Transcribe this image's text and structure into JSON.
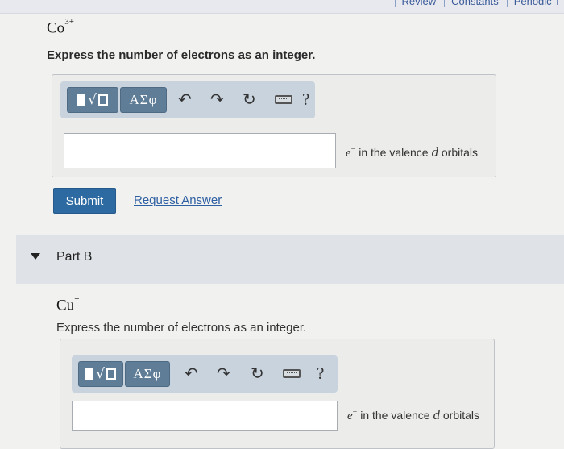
{
  "header": {
    "links": [
      "Review",
      "Constants",
      "Periodic T"
    ]
  },
  "part_a": {
    "species_base": "Co",
    "species_charge": "3+",
    "prompt": "Express the number of electrons as an integer.",
    "toolbar": {
      "template_label": "√",
      "greek_label": "ΑΣφ",
      "help_label": "?"
    },
    "input_value": "",
    "unit_e": "e",
    "unit_e_sup": "−",
    "unit_mid": " in the valence ",
    "unit_d": "d",
    "unit_end": " orbitals",
    "submit_label": "Submit",
    "request_label": "Request Answer"
  },
  "part_b": {
    "title": "Part B",
    "species_base": "Cu",
    "species_charge": "+",
    "prompt": "Express the number of electrons as an integer.",
    "toolbar": {
      "template_label": "√",
      "greek_label": "ΑΣφ",
      "help_label": "?"
    },
    "input_value": "",
    "unit_e": "e",
    "unit_e_sup": "−",
    "unit_mid": " in the valence ",
    "unit_d": "d",
    "unit_end": " orbitals"
  }
}
